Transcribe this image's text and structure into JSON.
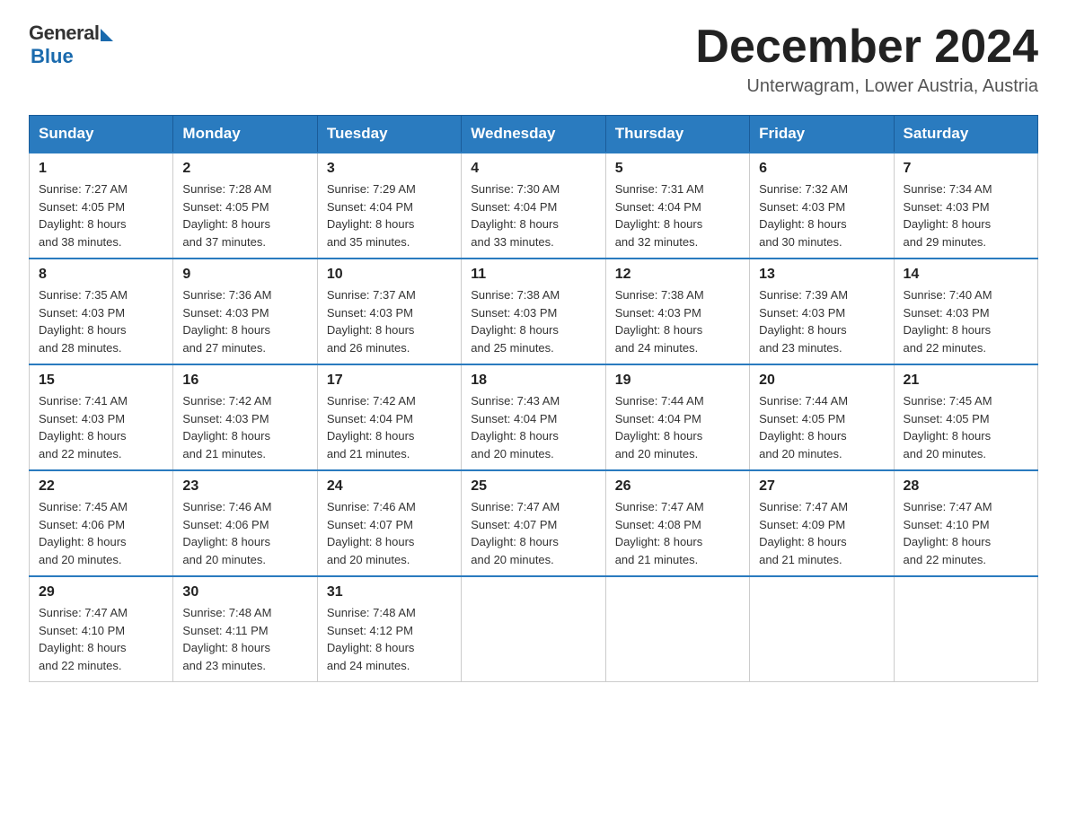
{
  "header": {
    "logo_general": "General",
    "logo_blue": "Blue",
    "month_title": "December 2024",
    "location": "Unterwagram, Lower Austria, Austria"
  },
  "weekdays": [
    "Sunday",
    "Monday",
    "Tuesday",
    "Wednesday",
    "Thursday",
    "Friday",
    "Saturday"
  ],
  "weeks": [
    [
      {
        "day": "1",
        "sunrise": "7:27 AM",
        "sunset": "4:05 PM",
        "daylight": "8 hours and 38 minutes."
      },
      {
        "day": "2",
        "sunrise": "7:28 AM",
        "sunset": "4:05 PM",
        "daylight": "8 hours and 37 minutes."
      },
      {
        "day": "3",
        "sunrise": "7:29 AM",
        "sunset": "4:04 PM",
        "daylight": "8 hours and 35 minutes."
      },
      {
        "day": "4",
        "sunrise": "7:30 AM",
        "sunset": "4:04 PM",
        "daylight": "8 hours and 33 minutes."
      },
      {
        "day": "5",
        "sunrise": "7:31 AM",
        "sunset": "4:04 PM",
        "daylight": "8 hours and 32 minutes."
      },
      {
        "day": "6",
        "sunrise": "7:32 AM",
        "sunset": "4:03 PM",
        "daylight": "8 hours and 30 minutes."
      },
      {
        "day": "7",
        "sunrise": "7:34 AM",
        "sunset": "4:03 PM",
        "daylight": "8 hours and 29 minutes."
      }
    ],
    [
      {
        "day": "8",
        "sunrise": "7:35 AM",
        "sunset": "4:03 PM",
        "daylight": "8 hours and 28 minutes."
      },
      {
        "day": "9",
        "sunrise": "7:36 AM",
        "sunset": "4:03 PM",
        "daylight": "8 hours and 27 minutes."
      },
      {
        "day": "10",
        "sunrise": "7:37 AM",
        "sunset": "4:03 PM",
        "daylight": "8 hours and 26 minutes."
      },
      {
        "day": "11",
        "sunrise": "7:38 AM",
        "sunset": "4:03 PM",
        "daylight": "8 hours and 25 minutes."
      },
      {
        "day": "12",
        "sunrise": "7:38 AM",
        "sunset": "4:03 PM",
        "daylight": "8 hours and 24 minutes."
      },
      {
        "day": "13",
        "sunrise": "7:39 AM",
        "sunset": "4:03 PM",
        "daylight": "8 hours and 23 minutes."
      },
      {
        "day": "14",
        "sunrise": "7:40 AM",
        "sunset": "4:03 PM",
        "daylight": "8 hours and 22 minutes."
      }
    ],
    [
      {
        "day": "15",
        "sunrise": "7:41 AM",
        "sunset": "4:03 PM",
        "daylight": "8 hours and 22 minutes."
      },
      {
        "day": "16",
        "sunrise": "7:42 AM",
        "sunset": "4:03 PM",
        "daylight": "8 hours and 21 minutes."
      },
      {
        "day": "17",
        "sunrise": "7:42 AM",
        "sunset": "4:04 PM",
        "daylight": "8 hours and 21 minutes."
      },
      {
        "day": "18",
        "sunrise": "7:43 AM",
        "sunset": "4:04 PM",
        "daylight": "8 hours and 20 minutes."
      },
      {
        "day": "19",
        "sunrise": "7:44 AM",
        "sunset": "4:04 PM",
        "daylight": "8 hours and 20 minutes."
      },
      {
        "day": "20",
        "sunrise": "7:44 AM",
        "sunset": "4:05 PM",
        "daylight": "8 hours and 20 minutes."
      },
      {
        "day": "21",
        "sunrise": "7:45 AM",
        "sunset": "4:05 PM",
        "daylight": "8 hours and 20 minutes."
      }
    ],
    [
      {
        "day": "22",
        "sunrise": "7:45 AM",
        "sunset": "4:06 PM",
        "daylight": "8 hours and 20 minutes."
      },
      {
        "day": "23",
        "sunrise": "7:46 AM",
        "sunset": "4:06 PM",
        "daylight": "8 hours and 20 minutes."
      },
      {
        "day": "24",
        "sunrise": "7:46 AM",
        "sunset": "4:07 PM",
        "daylight": "8 hours and 20 minutes."
      },
      {
        "day": "25",
        "sunrise": "7:47 AM",
        "sunset": "4:07 PM",
        "daylight": "8 hours and 20 minutes."
      },
      {
        "day": "26",
        "sunrise": "7:47 AM",
        "sunset": "4:08 PM",
        "daylight": "8 hours and 21 minutes."
      },
      {
        "day": "27",
        "sunrise": "7:47 AM",
        "sunset": "4:09 PM",
        "daylight": "8 hours and 21 minutes."
      },
      {
        "day": "28",
        "sunrise": "7:47 AM",
        "sunset": "4:10 PM",
        "daylight": "8 hours and 22 minutes."
      }
    ],
    [
      {
        "day": "29",
        "sunrise": "7:47 AM",
        "sunset": "4:10 PM",
        "daylight": "8 hours and 22 minutes."
      },
      {
        "day": "30",
        "sunrise": "7:48 AM",
        "sunset": "4:11 PM",
        "daylight": "8 hours and 23 minutes."
      },
      {
        "day": "31",
        "sunrise": "7:48 AM",
        "sunset": "4:12 PM",
        "daylight": "8 hours and 24 minutes."
      },
      null,
      null,
      null,
      null
    ]
  ],
  "labels": {
    "sunrise": "Sunrise:",
    "sunset": "Sunset:",
    "daylight": "Daylight:"
  }
}
